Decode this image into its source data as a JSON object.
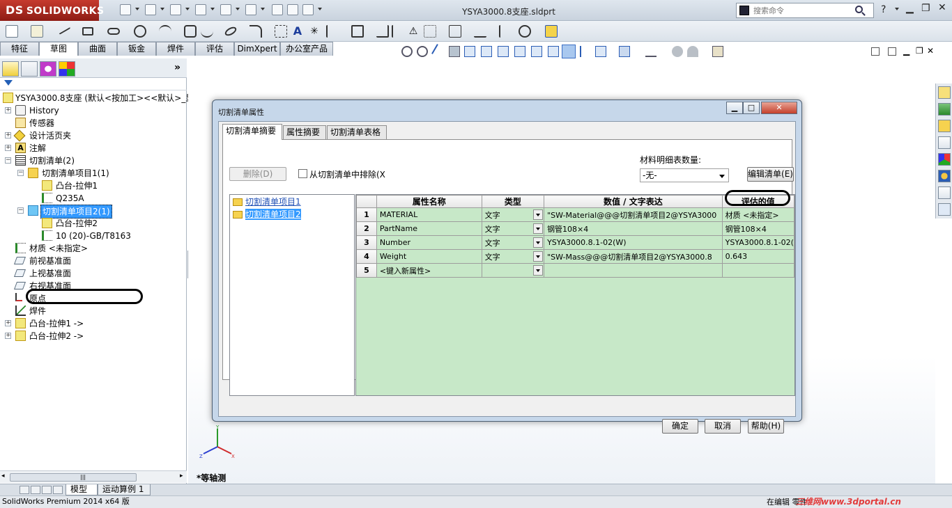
{
  "app": {
    "logo": "SOLIDWORKS",
    "logo_mark": "DS",
    "doc_title": "YSYA3000.8支座.sldprt",
    "search_placeholder": "搜索命令",
    "help": "?"
  },
  "cm_tabs": [
    "特征",
    "草图",
    "曲面",
    "钣金",
    "焊件",
    "评估",
    "DimXpert",
    "办公室产品"
  ],
  "tree": {
    "root": "YSYA3000.8支座  (默认<按加工><<默认>_显",
    "history": "History",
    "sensors": "传感器",
    "design_binder": "设计活页夹",
    "annotations": "注解",
    "cut_list": "切割清单(2)",
    "cut_item_1": "切割清单项目1(1)",
    "cut_item_1_feat": "凸台-拉伸1",
    "cut_item_1_mat": "Q235A",
    "cut_item_2": "切割清单项目2(1)",
    "cut_item_2_feat": "凸台-拉伸2",
    "cut_item_2_desc": "10 (20)-GB/T8163",
    "material": "材质 <未指定>",
    "front_plane": "前视基准面",
    "top_plane": "上视基准面",
    "right_plane": "右视基准面",
    "origin": "原点",
    "weldment": "焊件",
    "boss1": "凸台-拉伸1 ->",
    "boss2": "凸台-拉伸2 ->"
  },
  "dialog": {
    "title": "切割清单属性",
    "tabs": [
      "切割清单摘要",
      "属性摘要",
      "切割清单表格"
    ],
    "delete_btn": "删除(D)",
    "exclude_label": "从切割清单中排除(X",
    "bom_label": "材料明细表数量:",
    "bom_value": "-无-",
    "edit_list_btn": "编辑清单(E)",
    "items": [
      "切割清单项目1",
      "切割清单项目2"
    ],
    "columns": [
      "属性名称",
      "类型",
      "数值 / 文字表达",
      "评估的值"
    ],
    "rows": [
      {
        "n": "1",
        "name": "MATERIAL",
        "type": "文字",
        "expr": "\"SW-Material@@@切割清单项目2@YSYA3000",
        "value": "材质 <未指定>"
      },
      {
        "n": "2",
        "name": "PartName",
        "type": "文字",
        "expr": "钢管108×4",
        "value": "钢管108×4"
      },
      {
        "n": "3",
        "name": "Number",
        "type": "文字",
        "expr": "YSYA3000.8.1-02(W)",
        "value": "YSYA3000.8.1-02("
      },
      {
        "n": "4",
        "name": "Weight",
        "type": "文字",
        "expr": "\"SW-Mass@@@切割清单项目2@YSYA3000.8",
        "value": "0.643"
      },
      {
        "n": "5",
        "name": "<键入新属性>",
        "type": "",
        "expr": "",
        "value": ""
      }
    ],
    "ok_btn": "确定",
    "cancel_btn": "取消",
    "help_btn": "帮助(H)"
  },
  "graphics": {
    "view_label": "*等轴测",
    "triad_x": "X",
    "triad_y": "Y",
    "triad_z": "Z"
  },
  "bottom_tabs": [
    "模型",
    "运动算例 1"
  ],
  "status": {
    "left": "SolidWorks Premium 2014 x64 版",
    "right": "在编辑 零件",
    "watermark": "三维网www.3dportal.cn"
  }
}
